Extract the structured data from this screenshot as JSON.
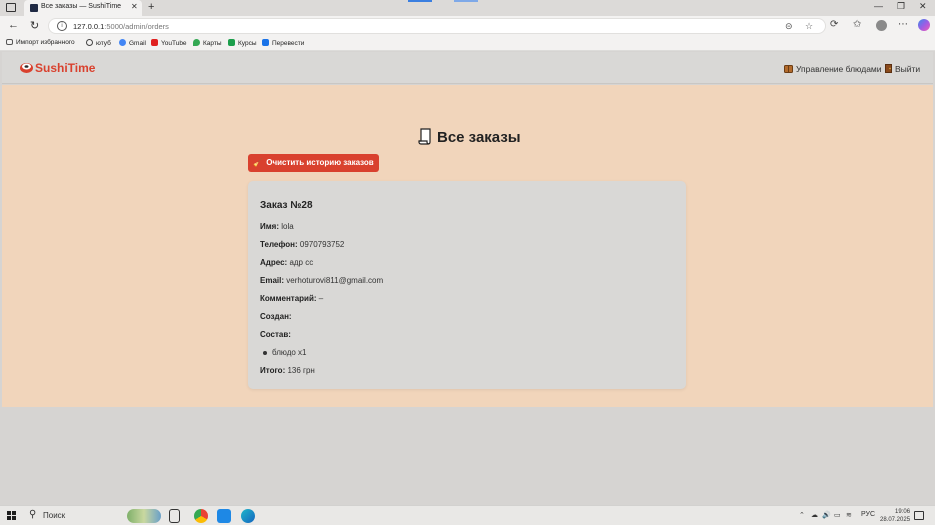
{
  "browser": {
    "tab_title": "Все заказы — SushiTime",
    "url_host": "127.0.0.1",
    "url_path": ":5000/admin/orders",
    "bookmarks": [
      {
        "label": "Импорт избранного",
        "color": "#555555"
      },
      {
        "label": "ютуб",
        "color": "#444444"
      },
      {
        "label": "Gmail",
        "color": "#4285f4"
      },
      {
        "label": "YouTube",
        "color": "#e02020"
      },
      {
        "label": "Карты",
        "color": "#34a853"
      },
      {
        "label": "Курсы",
        "color": "#1b9e4b"
      },
      {
        "label": "Перевести",
        "color": "#1a73e8"
      }
    ]
  },
  "site": {
    "logo": "SushiTime",
    "nav": {
      "manage_dishes": "Управление блюдами",
      "logout": "Выйти"
    },
    "accent": "#d9412e"
  },
  "page": {
    "title": "Все заказы",
    "clear_button": "Очистить историю заказов"
  },
  "order": {
    "title": "Заказ №28",
    "name_label": "Имя:",
    "name_value": "lola",
    "phone_label": "Телефон:",
    "phone_value": "0970793752",
    "address_label": "Адрес:",
    "address_value": "адр сс",
    "email_label": "Email:",
    "email_value": "verhoturovi811@gmail.com",
    "comment_label": "Комментарий:",
    "comment_value": "–",
    "created_label": "Создан:",
    "created_value": "",
    "items_label": "Состав:",
    "items": [
      "блюдо x1"
    ],
    "total_label": "Итого:",
    "total_value": "136 грн"
  },
  "taskbar": {
    "search": "Поиск",
    "lang": "РУС",
    "time": "19:06",
    "date": "28.07.2025"
  }
}
